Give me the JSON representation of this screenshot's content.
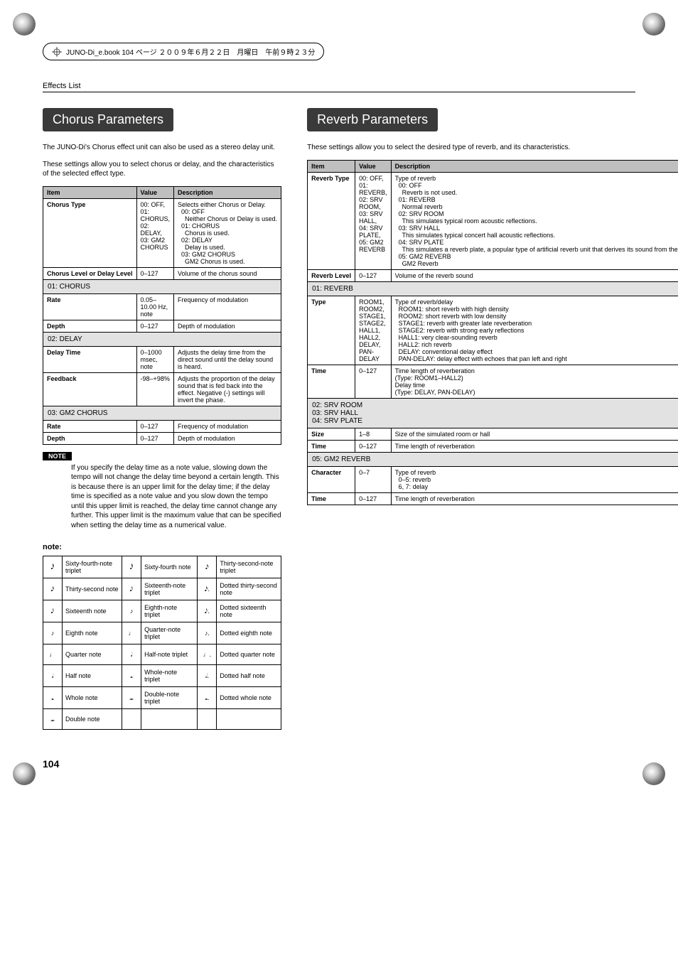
{
  "header": {
    "booktag": "JUNO-Di_e.book  104 ページ  ２００９年６月２２日　月曜日　午前９時２３分"
  },
  "section_label": "Effects List",
  "page_number": "104",
  "chorus": {
    "title": "Chorus Parameters",
    "intro1": "The JUNO-Di's Chorus effect unit can also be used as a stereo delay unit.",
    "intro2": "These settings allow you to select chorus or delay, and the characteristics of the selected effect type.",
    "head": {
      "item": "Item",
      "value": "Value",
      "desc": "Description"
    },
    "rows": {
      "chorusType": {
        "item": "Chorus Type",
        "value": "00: OFF,\n01: CHORUS,\n02: DELAY,\n03: GM2 CHORUS",
        "desc": "Selects either Chorus or Delay.\n  00: OFF\n    Neither Chorus or Delay is used.\n  01: CHORUS\n    Chorus is used.\n  02: DELAY\n    Delay is used.\n  03: GM2 CHORUS\n    GM2 Chorus is used."
      },
      "chorusLevel": {
        "item": "Chorus Level or Delay Level",
        "value": "0–127",
        "desc": "Volume of the chorus sound"
      }
    },
    "sub01": "01: CHORUS",
    "sub01rows": {
      "rate": {
        "item": "Rate",
        "value": "0.05–10.00 Hz, note",
        "desc": "Frequency of modulation"
      },
      "depth": {
        "item": "Depth",
        "value": "0–127",
        "desc": "Depth of modulation"
      }
    },
    "sub02": "02: DELAY",
    "sub02rows": {
      "delayTime": {
        "item": "Delay Time",
        "value": "0–1000 msec, note",
        "desc": "Adjusts the delay time from the direct sound until the delay sound is heard."
      },
      "feedback": {
        "item": "Feedback",
        "value": "-98–+98%",
        "desc": "Adjusts the proportion of the delay sound that is fed back into the effect. Negative (-) settings will invert the phase."
      }
    },
    "sub03": "03: GM2 CHORUS",
    "sub03rows": {
      "rate": {
        "item": "Rate",
        "value": "0–127",
        "desc": "Frequency of modulation"
      },
      "depth": {
        "item": "Depth",
        "value": "0–127",
        "desc": "Depth of modulation"
      }
    },
    "noteBadge": "NOTE",
    "noteText": "If you specify the delay time as a note value, slowing down the tempo will not change the delay time beyond a certain length. This is because there is an upper limit for the delay time; if the delay time is specified as a note value and you slow down the tempo until this upper limit is reached, the delay time cannot change any further. This upper limit is the maximum value that can be specified when setting the delay time as a numerical value.",
    "noteLabel": "note:",
    "noteTable": [
      [
        "Sixty-fourth-note triplet",
        "Sixty-fourth note",
        "Thirty-second-note triplet"
      ],
      [
        "Thirty-second note",
        "Sixteenth-note triplet",
        "Dotted thirty-second note"
      ],
      [
        "Sixteenth note",
        "Eighth-note triplet",
        "Dotted sixteenth note"
      ],
      [
        "Eighth note",
        "Quarter-note triplet",
        "Dotted eighth note"
      ],
      [
        "Quarter note",
        "Half-note triplet",
        "Dotted quarter note"
      ],
      [
        "Half note",
        "Whole-note triplet",
        "Dotted half note"
      ],
      [
        "Whole note",
        "Double-note triplet",
        "Dotted whole note"
      ],
      [
        "Double note",
        "",
        ""
      ]
    ]
  },
  "reverb": {
    "title": "Reverb Parameters",
    "intro": "These settings allow you to select the desired type of reverb, and its characteristics.",
    "head": {
      "item": "Item",
      "value": "Value",
      "desc": "Description"
    },
    "rows": {
      "type": {
        "item": "Reverb Type",
        "value": "00: OFF,\n01: REVERB,\n02: SRV ROOM,\n03: SRV HALL,\n04: SRV PLATE,\n05: GM2 REVERB",
        "desc": "Type of reverb\n  00: OFF\n    Reverb is not used.\n  01: REVERB\n    Normal reverb\n  02: SRV ROOM\n    This simulates typical room acoustic reflections.\n  03: SRV HALL\n    This simulates typical concert hall acoustic reflections.\n  04: SRV PLATE\n    This simulates a reverb plate, a popular type of artificial reverb unit that derives its sound from the vibration of a metallic plate.\n  05: GM2 REVERB\n    GM2 Reverb"
      },
      "level": {
        "item": "Reverb Level",
        "value": "0–127",
        "desc": "Volume of the reverb sound"
      }
    },
    "sub01": "01: REVERB",
    "sub01rows": {
      "type": {
        "item": "Type",
        "value": "ROOM1, ROOM2,\nSTAGE1, STAGE2,\nHALL1, HALL2,\nDELAY,\nPAN-DELAY",
        "desc": "Type of reverb/delay\n  ROOM1: short reverb with high density\n  ROOM2: short reverb with low density\n  STAGE1: reverb with greater late reverberation\n  STAGE2: reverb with strong early reflections\n  HALL1: very clear-sounding reverb\n  HALL2: rich reverb\n  DELAY: conventional delay effect\n  PAN-DELAY: delay effect with echoes that pan left and right"
      },
      "time": {
        "item": "Time",
        "value": "0–127",
        "desc": "Time length of reverberation\n(Type: ROOM1–HALL2)\nDelay time\n(Type: DELAY, PAN-DELAY)"
      }
    },
    "sub0204": "02: SRV ROOM\n03: SRV HALL\n04: SRV PLATE",
    "sub0204rows": {
      "size": {
        "item": "Size",
        "value": "1–8",
        "desc": "Size of the simulated room or hall"
      },
      "time": {
        "item": "Time",
        "value": "0–127",
        "desc": "Time length of reverberation"
      }
    },
    "sub05": "05: GM2 REVERB",
    "sub05rows": {
      "character": {
        "item": "Character",
        "value": "0–7",
        "desc": "Type of reverb\n  0–5: reverb\n  6, 7: delay"
      },
      "time": {
        "item": "Time",
        "value": "0–127",
        "desc": "Time length of reverberation"
      }
    }
  }
}
